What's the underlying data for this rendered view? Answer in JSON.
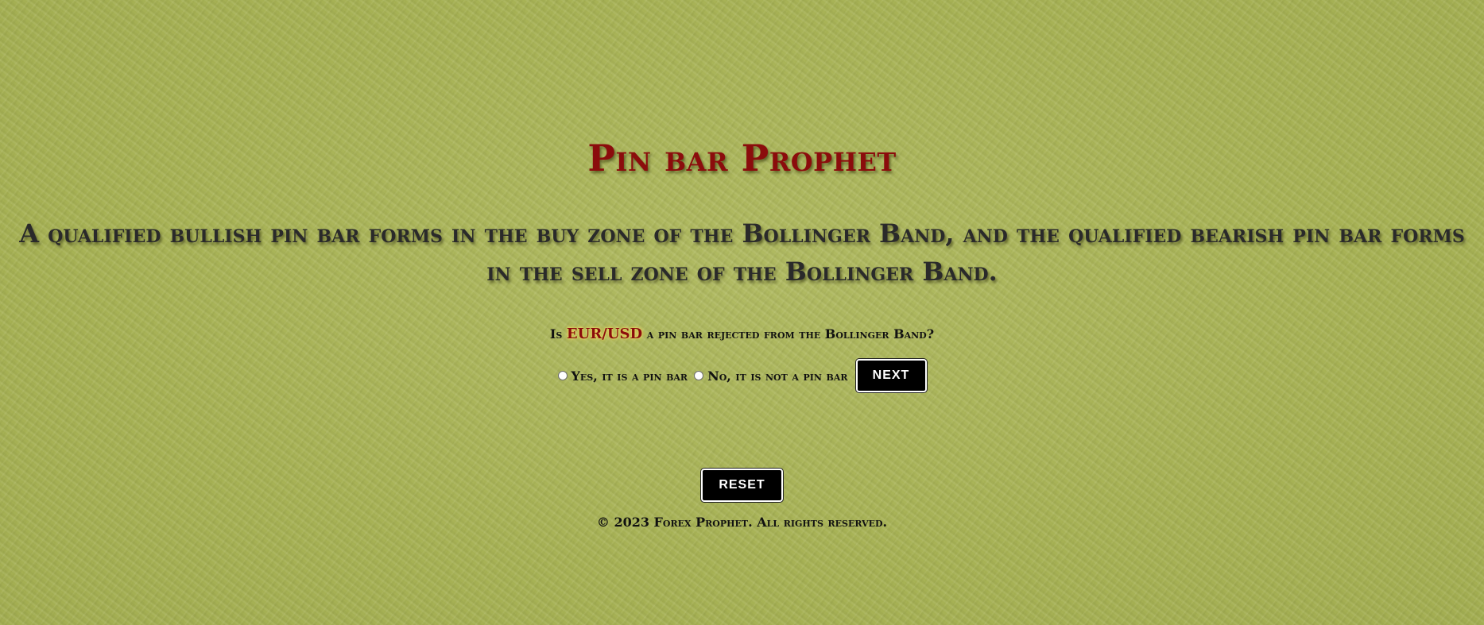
{
  "header": {
    "title": "Pin bar Prophet",
    "subtitle": "A qualified bullish pin bar forms in the buy zone of the Bollinger Band, and the qualified bearish pin bar forms in the sell zone of the Bollinger Band."
  },
  "quiz": {
    "question_prefix": "Is",
    "pair": "EUR/USD",
    "question_suffix": "a pin bar rejected from the Bollinger Band?",
    "options": [
      {
        "label": "Yes, it is a pin bar",
        "selected": false
      },
      {
        "label": "No, it is not a pin bar",
        "selected": false
      }
    ],
    "next_label": "NEXT"
  },
  "actions": {
    "reset_label": "RESET"
  },
  "footer": {
    "copyright": "© 2023 Forex Prophet. All rights reserved."
  },
  "colors": {
    "background": "#a8b457",
    "title": "#8b0c0c",
    "subtitle": "#2a2a2a",
    "button_bg": "#000000",
    "button_text": "#ffffff"
  }
}
